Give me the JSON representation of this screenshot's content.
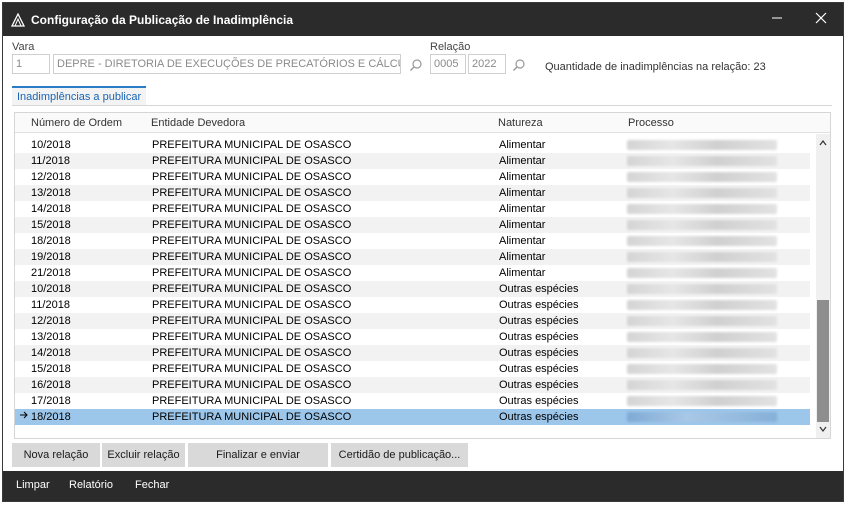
{
  "window": {
    "title": "Configuração da Publicação de Inadimplência"
  },
  "vara": {
    "label": "Vara",
    "code": "1",
    "name": "DEPRE - DIRETORIA DE EXECUÇÕES DE PRECATÓRIOS E CÁLCULOS"
  },
  "relacao": {
    "label": "Relação",
    "number": "0005",
    "year": "2022"
  },
  "quantidade": "Quantidade de inadimplências na relação: 23",
  "tab": {
    "label": "Inadimplências a publicar"
  },
  "grid": {
    "headers": {
      "ordem": "Número de Ordem",
      "entidade": "Entidade Devedora",
      "natureza": "Natureza",
      "processo": "Processo"
    },
    "rows": [
      {
        "ordem": "10/2018",
        "entidade": "PREFEITURA MUNICIPAL DE OSASCO",
        "natureza": "Alimentar"
      },
      {
        "ordem": "11/2018",
        "entidade": "PREFEITURA MUNICIPAL DE OSASCO",
        "natureza": "Alimentar"
      },
      {
        "ordem": "12/2018",
        "entidade": "PREFEITURA MUNICIPAL DE OSASCO",
        "natureza": "Alimentar"
      },
      {
        "ordem": "13/2018",
        "entidade": "PREFEITURA MUNICIPAL DE OSASCO",
        "natureza": "Alimentar"
      },
      {
        "ordem": "14/2018",
        "entidade": "PREFEITURA MUNICIPAL DE OSASCO",
        "natureza": "Alimentar"
      },
      {
        "ordem": "15/2018",
        "entidade": "PREFEITURA MUNICIPAL DE OSASCO",
        "natureza": "Alimentar"
      },
      {
        "ordem": "18/2018",
        "entidade": "PREFEITURA MUNICIPAL DE OSASCO",
        "natureza": "Alimentar"
      },
      {
        "ordem": "19/2018",
        "entidade": "PREFEITURA MUNICIPAL DE OSASCO",
        "natureza": "Alimentar"
      },
      {
        "ordem": "21/2018",
        "entidade": "PREFEITURA MUNICIPAL DE OSASCO",
        "natureza": "Alimentar"
      },
      {
        "ordem": "10/2018",
        "entidade": "PREFEITURA MUNICIPAL DE OSASCO",
        "natureza": "Outras espécies"
      },
      {
        "ordem": "11/2018",
        "entidade": "PREFEITURA MUNICIPAL DE OSASCO",
        "natureza": "Outras espécies"
      },
      {
        "ordem": "12/2018",
        "entidade": "PREFEITURA MUNICIPAL DE OSASCO",
        "natureza": "Outras espécies"
      },
      {
        "ordem": "13/2018",
        "entidade": "PREFEITURA MUNICIPAL DE OSASCO",
        "natureza": "Outras espécies"
      },
      {
        "ordem": "14/2018",
        "entidade": "PREFEITURA MUNICIPAL DE OSASCO",
        "natureza": "Outras espécies"
      },
      {
        "ordem": "15/2018",
        "entidade": "PREFEITURA MUNICIPAL DE OSASCO",
        "natureza": "Outras espécies"
      },
      {
        "ordem": "16/2018",
        "entidade": "PREFEITURA MUNICIPAL DE OSASCO",
        "natureza": "Outras espécies"
      },
      {
        "ordem": "17/2018",
        "entidade": "PREFEITURA MUNICIPAL DE OSASCO",
        "natureza": "Outras espécies"
      },
      {
        "ordem": "18/2018",
        "entidade": "PREFEITURA MUNICIPAL DE OSASCO",
        "natureza": "Outras espécies",
        "selected": true
      }
    ]
  },
  "buttons": {
    "nova": "Nova relação",
    "excluir": "Excluir relação",
    "finalizar": "Finalizar e enviar",
    "certidao": "Certidão de publicação..."
  },
  "footer": {
    "limpar": "Limpar",
    "relatorio": "Relatório",
    "fechar": "Fechar"
  },
  "icons": {
    "app": "app-logo-icon",
    "minimize": "minimize-icon",
    "close": "close-icon",
    "search": "search-icon",
    "row_pointer": "row-pointer-icon"
  },
  "colors": {
    "titlebar": "#2b2b2b",
    "selection": "#9cc6ea",
    "tab_accent": "#2a7cc7"
  }
}
